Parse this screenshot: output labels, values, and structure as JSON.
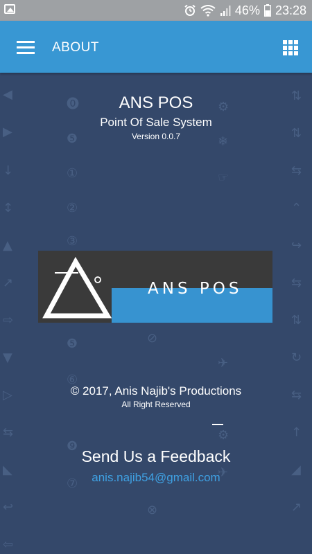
{
  "status_bar": {
    "battery_text": "46%",
    "time": "23:28",
    "icons": [
      "image-icon",
      "alarm-icon",
      "wifi-icon",
      "signal-icon",
      "battery-icon"
    ]
  },
  "app_bar": {
    "title": "ABOUT",
    "color": "#3897d3",
    "left_icon": "hamburger-menu-icon",
    "right_icon": "apps-grid-icon"
  },
  "about": {
    "app_name": "ANS POS",
    "subtitle": "Point Of Sale System",
    "version": "Version 0.0.7",
    "logo_text": "ANS POS",
    "copyright": "© 2017, Anis Najib's Productions",
    "rights": "All Right Reserved"
  },
  "feedback": {
    "title": "Send Us a Feedback",
    "email": "anis.najib54@gmail.com",
    "email_color": "#3fa1e3"
  },
  "theme": {
    "background": "#34486a",
    "status_bar": "#9ea1a4"
  }
}
